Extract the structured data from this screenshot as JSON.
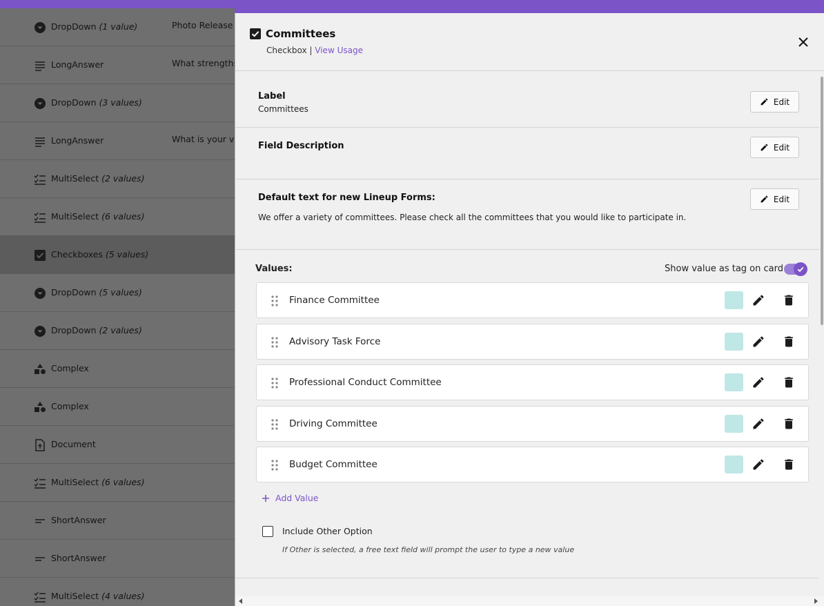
{
  "background_list": [
    {
      "icon": "dropdown-icon",
      "type": "DropDown",
      "count": "(1 value)",
      "question": "Photo Release C"
    },
    {
      "icon": "long-answer-icon",
      "type": "LongAnswer",
      "count": "",
      "question": "What strengths,"
    },
    {
      "icon": "dropdown-icon",
      "type": "DropDown",
      "count": "(3 values)",
      "question": ""
    },
    {
      "icon": "long-answer-icon",
      "type": "LongAnswer",
      "count": "",
      "question": "What is your vis"
    },
    {
      "icon": "multiselect-icon",
      "type": "MultiSelect",
      "count": "(2 values)",
      "question": ""
    },
    {
      "icon": "multiselect-icon",
      "type": "MultiSelect",
      "count": "(6 values)",
      "question": ""
    },
    {
      "icon": "checkbox-icon",
      "type": "Checkboxes",
      "count": "(5 values)",
      "question": "",
      "active": true
    },
    {
      "icon": "dropdown-icon",
      "type": "DropDown",
      "count": "(5 values)",
      "question": ""
    },
    {
      "icon": "dropdown-icon",
      "type": "DropDown",
      "count": "(2 values)",
      "question": ""
    },
    {
      "icon": "complex-icon",
      "type": "Complex",
      "count": "",
      "question": ""
    },
    {
      "icon": "complex-icon",
      "type": "Complex",
      "count": "",
      "question": ""
    },
    {
      "icon": "document-icon",
      "type": "Document",
      "count": "",
      "question": ""
    },
    {
      "icon": "multiselect-icon",
      "type": "MultiSelect",
      "count": "(6 values)",
      "question": ""
    },
    {
      "icon": "short-answer-icon",
      "type": "ShortAnswer",
      "count": "",
      "question": ""
    },
    {
      "icon": "short-answer-icon",
      "type": "ShortAnswer",
      "count": "",
      "question": ""
    },
    {
      "icon": "multiselect-icon",
      "type": "MultiSelect",
      "count": "(4 values)",
      "question": ""
    }
  ],
  "panel": {
    "title": "Committees",
    "subtitle_type": "Checkbox",
    "subtitle_sep": " | ",
    "view_usage": "View Usage",
    "label_heading": "Label",
    "label_value": "Committees",
    "description_heading": "Field Description",
    "default_heading": "Default text for new Lineup Forms:",
    "default_value": "We offer a variety of committees. Please check all the committees that you would like to participate in.",
    "edit_label": "Edit",
    "values_heading": "Values:",
    "show_tag_label": "Show value as tag on card",
    "show_tag_enabled": true,
    "values": [
      {
        "name": "Finance Committee",
        "color": "#bfe7e6"
      },
      {
        "name": "Advisory Task Force",
        "color": "#bfe7e6"
      },
      {
        "name": "Professional Conduct Committee",
        "color": "#bfe7e6"
      },
      {
        "name": "Driving Committee",
        "color": "#bfe7e6"
      },
      {
        "name": "Budget Committee",
        "color": "#bfe7e6"
      }
    ],
    "add_value": "Add Value",
    "other_option_label": "Include Other Option",
    "other_option_checked": false,
    "other_option_hint": "If Other is selected, a free text field will prompt the user to type a new value"
  },
  "colors": {
    "accent": "#7b54c8",
    "overlay": "#6f6f6f",
    "panel_bg": "#f0f0f0"
  }
}
